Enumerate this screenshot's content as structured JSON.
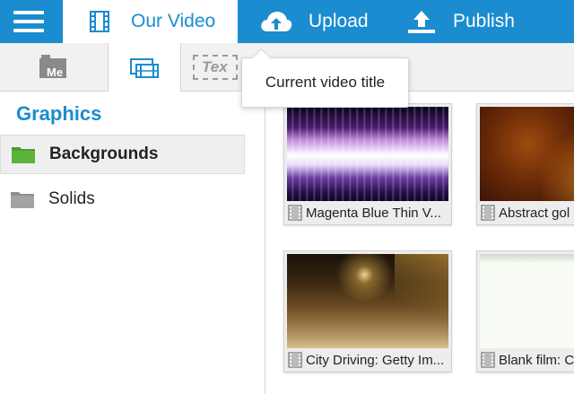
{
  "topbar": {
    "tabs": [
      {
        "label": "Our Video",
        "icon": "film-icon",
        "active": true
      },
      {
        "label": "Upload",
        "icon": "cloud-upload-icon",
        "active": false
      },
      {
        "label": "Publish",
        "icon": "publish-icon",
        "active": false
      }
    ]
  },
  "subtabs": [
    {
      "label": "Me",
      "icon": "media-icon"
    },
    {
      "label": "",
      "icon": "graphics-icon",
      "active": true
    },
    {
      "label": "Tex",
      "icon": "text-icon"
    }
  ],
  "tooltip": {
    "text": "Current video title"
  },
  "sidebar": {
    "title": "Graphics",
    "items": [
      {
        "label": "Backgrounds",
        "icon": "folder-icon",
        "active": true
      },
      {
        "label": "Solids",
        "icon": "folder-icon",
        "active": false
      }
    ]
  },
  "media": [
    {
      "caption": "Magenta Blue Thin V...",
      "thumb": "magenta-blue-lines"
    },
    {
      "caption": "Abstract gol",
      "thumb": "abstract-gold"
    },
    {
      "caption": "City Driving: Getty Im...",
      "thumb": "city-driving"
    },
    {
      "caption": "Blank film: C",
      "thumb": "blank-film"
    }
  ],
  "colors": {
    "brand": "#1a8ccf",
    "active_folder": "#4a9e2f",
    "folder": "#9a9a9a"
  }
}
